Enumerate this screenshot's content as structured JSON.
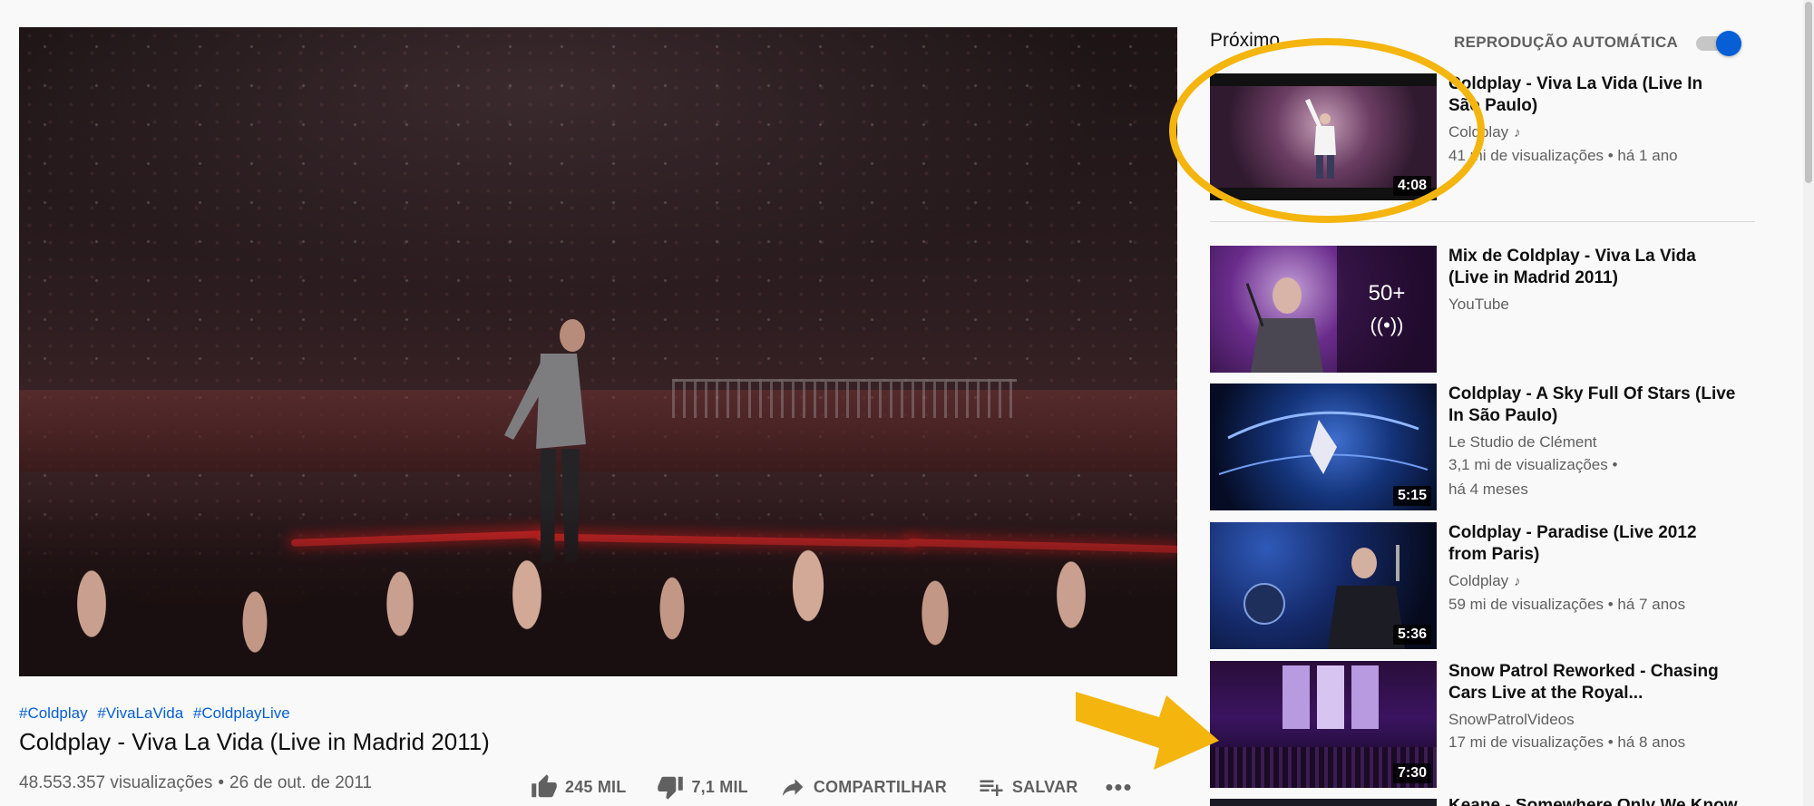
{
  "video": {
    "hashtags": [
      "#Coldplay",
      "#VivaLaVida",
      "#ColdplayLive"
    ],
    "title": "Coldplay - Viva La Vida (Live in Madrid 2011)",
    "views": "48.553.357 visualizações",
    "date": "26 de out. de 2011",
    "separator": "•",
    "actions": {
      "like": "245 MIL",
      "dislike": "7,1 MIL",
      "share": "COMPARTILHAR",
      "save": "SALVAR",
      "more": "•••"
    }
  },
  "sidebar": {
    "next_label": "Próximo",
    "autoplay_label": "REPRODUÇÃO AUTOMÁTICA",
    "autoplay_on": true,
    "items": [
      {
        "title": "Coldplay - Viva La Vida (Live In São Paulo)",
        "channel": "Coldplay",
        "music_note": "♪",
        "stats": "41 mi de visualizações • há 1 ano",
        "duration": "4:08"
      },
      {
        "title": "Mix de Coldplay - Viva La Vida (Live in Madrid 2011)",
        "channel": "YouTube",
        "mix_count": "50+",
        "mix_icon": "((•))"
      },
      {
        "title": "Coldplay - A Sky Full Of Stars (Live In São Paulo)",
        "channel": "Le Studio de Clément",
        "stats": "3,1 mi de visualizações •",
        "stats2": "há 4 meses",
        "duration": "5:15"
      },
      {
        "title": "Coldplay - Paradise (Live 2012 from Paris)",
        "channel": "Coldplay",
        "music_note": "♪",
        "stats": "59 mi de visualizações • há 7 anos",
        "duration": "5:36"
      },
      {
        "title": "Snow Patrol Reworked - Chasing Cars Live at the Royal...",
        "channel": "SnowPatrolVideos",
        "stats": "17 mi de visualizações • há 8 anos",
        "duration": "7:30"
      },
      {
        "title": "Keane - Somewhere Only We Know"
      }
    ]
  },
  "colors": {
    "accent": "#065fd4",
    "annotation": "#f5b50f",
    "text_secondary": "#606060"
  }
}
